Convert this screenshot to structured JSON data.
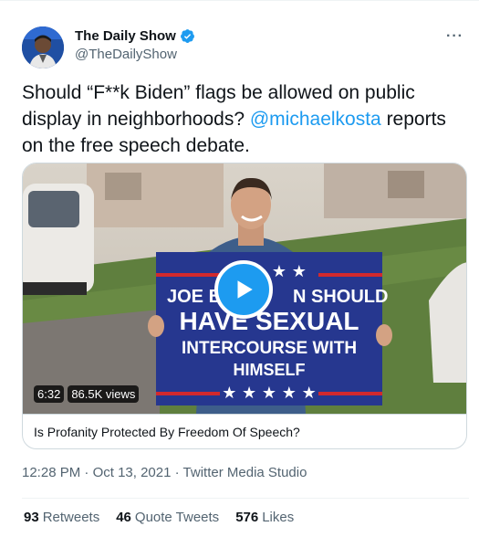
{
  "author": {
    "display_name": "The Daily Show",
    "handle": "@TheDailyShow",
    "verified": true,
    "more_icon": "more-horizontal-icon"
  },
  "tweet": {
    "text_before": "Should “F**k Biden” flags be allowed on public display in neighborhoods? ",
    "mention": "@michaelkosta",
    "text_after": " reports on the free speech debate."
  },
  "media": {
    "duration": "6:32",
    "views": "86.5K views",
    "title": "Is Profanity Protected By Freedom Of Speech?",
    "sign_lines": [
      "JOE B",
      "N SHOULD",
      "HAVE SEXUAL",
      "INTERCOURSE WITH",
      "HIMSELF"
    ],
    "play_icon": "play-icon"
  },
  "meta": {
    "time": "12:28 PM",
    "date": "Oct 13, 2021",
    "source": "Twitter Media Studio"
  },
  "stats": [
    {
      "count": "93",
      "label": "Retweets"
    },
    {
      "count": "46",
      "label": "Quote Tweets"
    },
    {
      "count": "576",
      "label": "Likes"
    }
  ],
  "colors": {
    "accent": "#1d9bf0",
    "text": "#0f1419",
    "secondary": "#536471",
    "sign_blue": "#26378f",
    "sign_red": "#d2292d"
  }
}
